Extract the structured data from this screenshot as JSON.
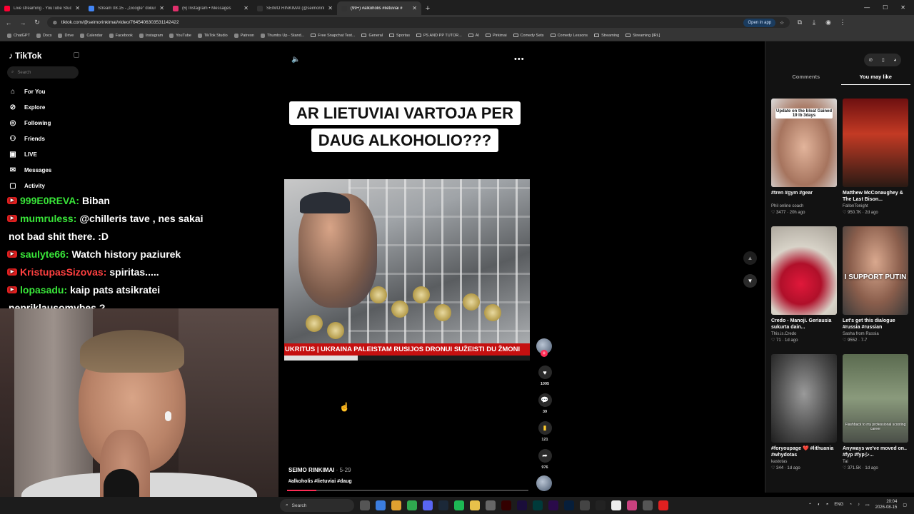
{
  "browser": {
    "tabs": [
      {
        "label": "Live streaming - YouTube Studio",
        "color": "#ff0033"
      },
      {
        "label": "Stream 08.15 - „Google“ dokum",
        "color": "#4285f4"
      },
      {
        "label": "(6) Instagram • Messages",
        "color": "#e1306c"
      },
      {
        "label": "SEIMO RINKIMAI (@seimorinki",
        "color": "#111111"
      },
      {
        "label": "(99+) #alkoholis #lietuviai #",
        "color": "#111111"
      }
    ],
    "url": "tiktok.com/@seimorinkimai/video/7645406303531142422",
    "open_in_app": "Open in app",
    "bookmarks": [
      "ChatGPT",
      "Docs",
      "Drive",
      "Calendar",
      "Facebook",
      "Instagram",
      "YouTube",
      "TikTok Studio",
      "Patreon",
      "Thumbs Up - Stand...",
      "Free Snapchat Test...",
      "General",
      "Sportas",
      "PS AND PP TUTOR...",
      "AI",
      "Pirkimai",
      "Comedy Sets",
      "Comedy Lessons",
      "Streaming",
      "Streaming [IRL]"
    ]
  },
  "tiktok": {
    "logo": "TikTok",
    "search_placeholder": "Search",
    "nav": [
      {
        "label": "For You",
        "icon": "home-icon"
      },
      {
        "label": "Explore",
        "icon": "compass-icon"
      },
      {
        "label": "Following",
        "icon": "following-icon"
      },
      {
        "label": "Friends",
        "icon": "friends-icon"
      },
      {
        "label": "LIVE",
        "icon": "live-icon"
      },
      {
        "label": "Messages",
        "icon": "messages-icon"
      },
      {
        "label": "Activity",
        "icon": "activity-icon"
      }
    ]
  },
  "chat": [
    {
      "user": "999E0REVA:",
      "message": " Biban",
      "color": "#39e639"
    },
    {
      "user": "mumruless:",
      "message": " @chilleris tave , nes sakai",
      "continuation": "not bad shit there. :D",
      "color": "#39e639"
    },
    {
      "user": "saulyte66:",
      "message": " Watch history paziurek",
      "color": "#39e639"
    },
    {
      "user": "KristupasSizovas:",
      "message": " spiritas.....",
      "color": "#ff4040"
    },
    {
      "user": "lopasadu:",
      "message": " kaip pats atsikratei",
      "continuation": "nepriklausomybes ?",
      "color": "#39e639"
    }
  ],
  "video": {
    "title_line1": "AR LIETUVIAI VARTOJA PER",
    "title_line2": "DAUG ALKOHOLIO???",
    "ticker": "UKRITUS | UKRAINA PALEISTAM RUSIJOS DRONUI SUŽEISTI DU ŽMONI",
    "author": "SEIMO RINKIMAI",
    "date": " · 5-29",
    "hashtags": "#alkoholis #lietuviai #daug",
    "likes": "1095",
    "comments": "39",
    "saves": "121",
    "shares": "976",
    "progress": 0.12
  },
  "right_panel": {
    "tabs": [
      "Comments",
      "You may like"
    ],
    "active_tab": "You may like",
    "cards": [
      {
        "overlay": "Update on the bloat Gained 19 lb 3days",
        "title": "#tren #gym #gear",
        "author": "Phil online coach",
        "meta": "♡ 3477 · 20h ago"
      },
      {
        "overlay": "",
        "title": "Matthew McConaughey & The Last Bison...",
        "author": "FallonTonight",
        "meta": "♡ 950.7K · 2d ago"
      },
      {
        "overlay": "",
        "title": "Credo - Manoji. Geriausia sukurta dain...",
        "author": "This.is.Credo",
        "meta": "♡ 71 · 1d ago"
      },
      {
        "overlay": "I SUPPORT PUTIN",
        "title": "Let's get this dialogue #russia #russian",
        "author": "Sasha from Russia",
        "meta": "♡ 9552 · 7-7"
      },
      {
        "overlay": "",
        "title": "#foryoupage ❤️ #lithuania ​#whydotas",
        "author": "kastotas",
        "meta": "♡ 344 · 1d ago"
      },
      {
        "overlay": "Flashback to my professional scooting career",
        "title": "Anyways we've moved on.. #fyp #fypシ...",
        "author": "Tai",
        "meta": "♡ 371.5K · 1d ago"
      }
    ]
  },
  "taskbar": {
    "search": "Search",
    "lang": "ENG",
    "time": "20:04",
    "date": "2026-08-15"
  }
}
